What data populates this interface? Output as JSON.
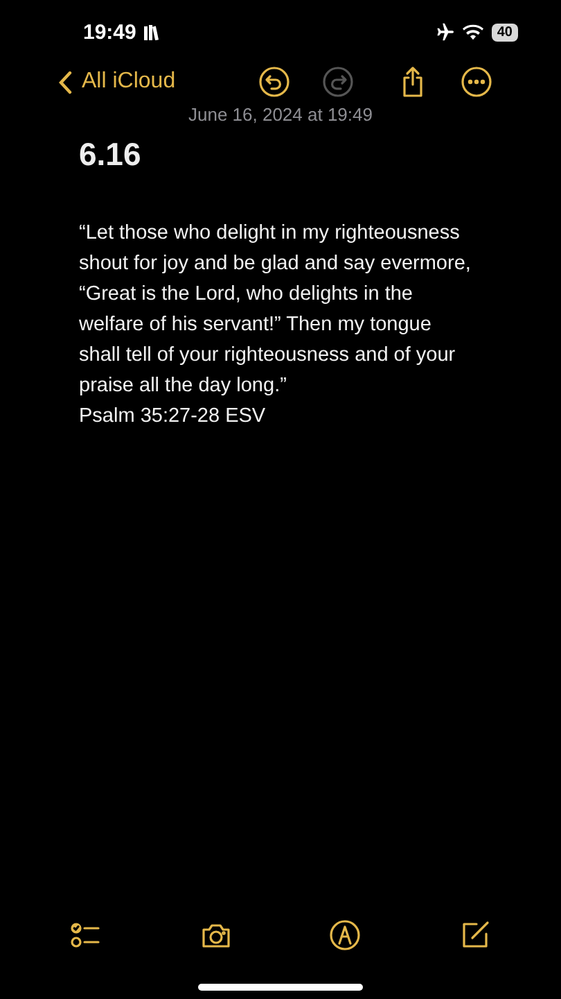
{
  "status_bar": {
    "time": "19:49",
    "battery": "40"
  },
  "nav": {
    "back_label": "All iCloud",
    "actions": [
      {
        "kind": "undo",
        "disabled": false
      },
      {
        "kind": "redo",
        "disabled": true
      },
      {
        "kind": "share",
        "disabled": false
      },
      {
        "kind": "more",
        "disabled": false
      }
    ]
  },
  "note": {
    "date": "June 16, 2024 at 19:49",
    "title": "6.16",
    "body_lines": [
      "“Let those who delight in my righteousness",
      "shout for joy and be glad and say evermore,",
      "“Great is the Lord, who delights in the",
      "welfare of his servant!” Then my tongue",
      "shall tell of your righteousness and of your",
      "praise all the day long.”"
    ],
    "reference": "Psalm 35:27-28 ESV"
  },
  "toolbar": [
    {
      "kind": "checklist"
    },
    {
      "kind": "camera"
    },
    {
      "kind": "markup"
    },
    {
      "kind": "compose"
    }
  ]
}
